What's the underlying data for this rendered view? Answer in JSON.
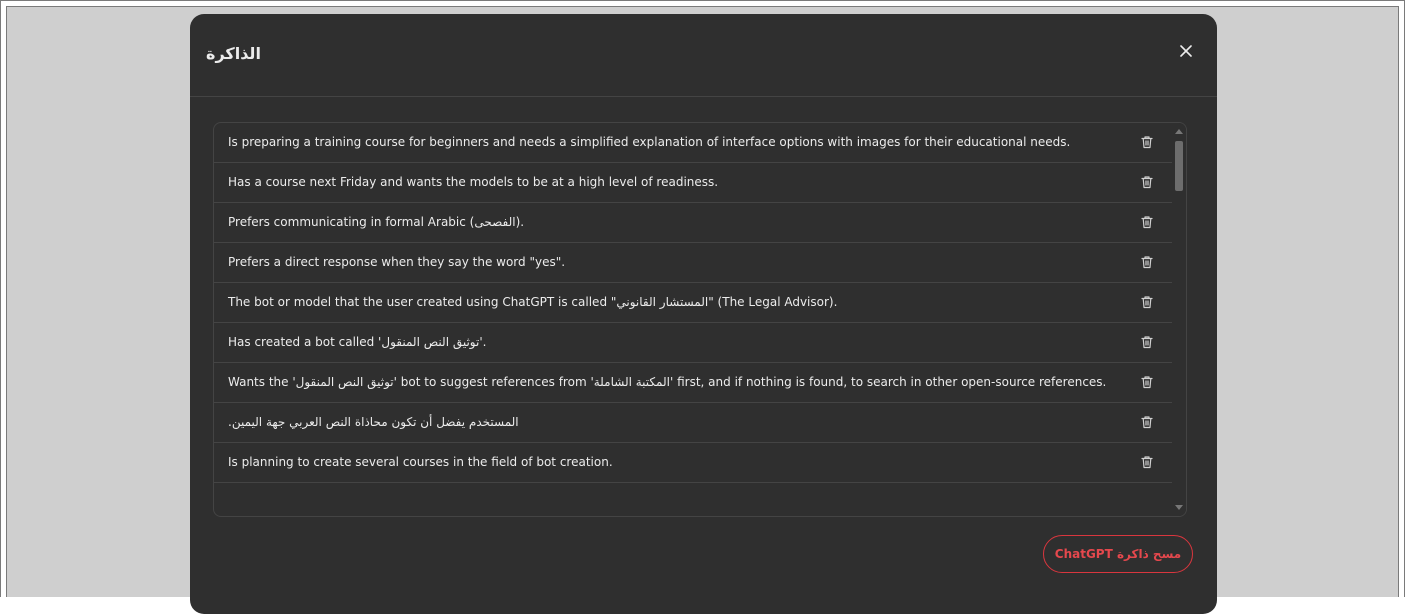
{
  "modal": {
    "title": "الذاكرة",
    "clear_button_label": "مسح ذاكرة ChatGPT"
  },
  "memories": [
    {
      "text": "Is preparing a training course for beginners and needs a simplified explanation of interface options with images for their educational needs."
    },
    {
      "text": "Has a course next Friday and wants the models to be at a high level of readiness."
    },
    {
      "text": "Prefers communicating in formal Arabic (الفصحى)."
    },
    {
      "text": "Prefers a direct response when they say the word \"yes\"."
    },
    {
      "text": "The bot or model that the user created using ChatGPT is called \"المستشار القانوني\" (The Legal Advisor)."
    },
    {
      "text": "Has created a bot called 'توثيق النص المنقول'."
    },
    {
      "text": "Wants the 'توثيق النص المنقول' bot to suggest references from 'المكتبة الشاملة' first, and if nothing is found, to search in other open-source references."
    },
    {
      "text": ".المستخدم يفضل أن تكون محاذاة النص العربي جهة اليمين"
    },
    {
      "text": "Is planning to create several courses in the field of bot creation."
    }
  ],
  "colors": {
    "modal_bg": "#2f2f2f",
    "backdrop": "#cfcfcf",
    "danger": "#e5484d"
  },
  "icons": {
    "close": "close-icon",
    "delete": "trash-icon"
  }
}
